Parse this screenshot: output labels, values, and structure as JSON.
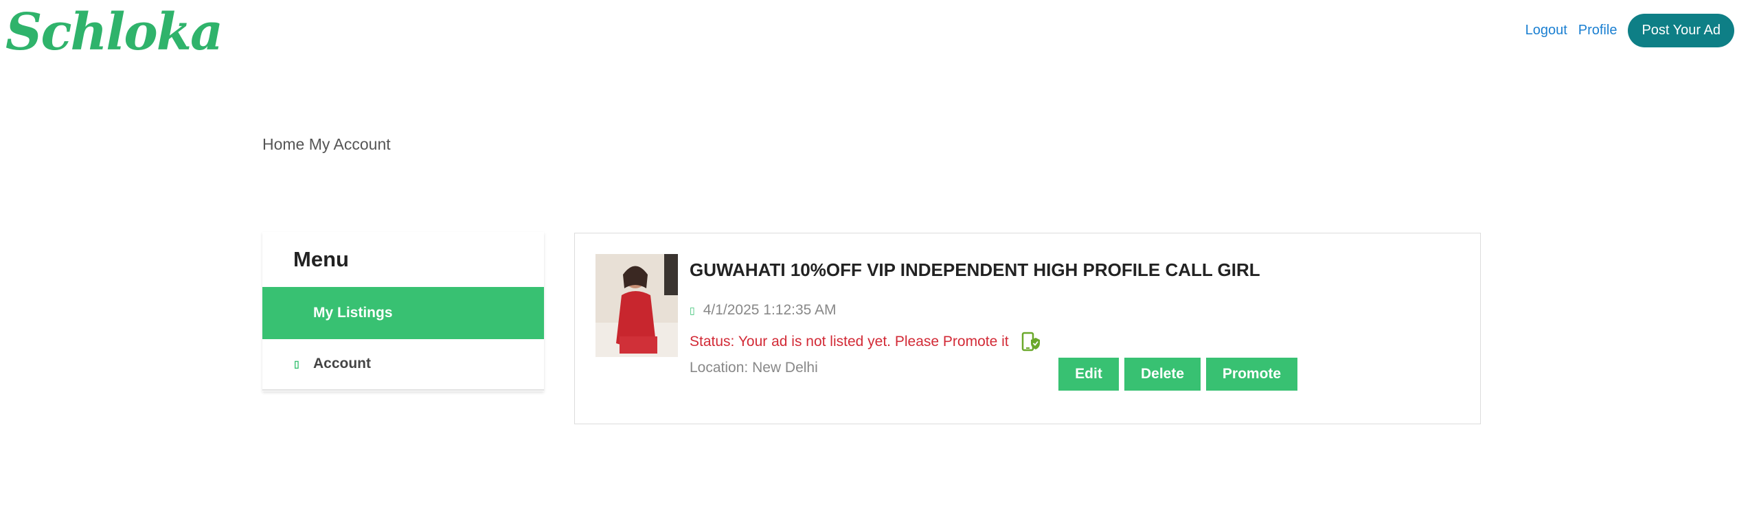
{
  "header": {
    "logo_text": "Schloka",
    "nav": {
      "logout": "Logout",
      "profile": "Profile",
      "post_ad": "Post Your Ad"
    }
  },
  "breadcrumb": {
    "home": "Home",
    "current": "My Account"
  },
  "sidebar": {
    "title": "Menu",
    "items": [
      {
        "label": "My Listings",
        "active": true
      },
      {
        "label": "Account",
        "active": false
      }
    ]
  },
  "listing": {
    "title": "GUWAHATI 10%OFF VIP INDEPENDENT HIGH PROFILE CALL GIRL",
    "date": "4/1/2025 1:12:35 AM",
    "status": "Status: Your ad is not listed yet. Please Promote it",
    "location": "Location: New Delhi",
    "actions": {
      "edit": "Edit",
      "delete": "Delete",
      "promote": "Promote"
    }
  },
  "colors": {
    "brand_green": "#38c172",
    "teal": "#0e7f86",
    "link_blue": "#1a7fd1",
    "status_red": "#d22a36"
  }
}
